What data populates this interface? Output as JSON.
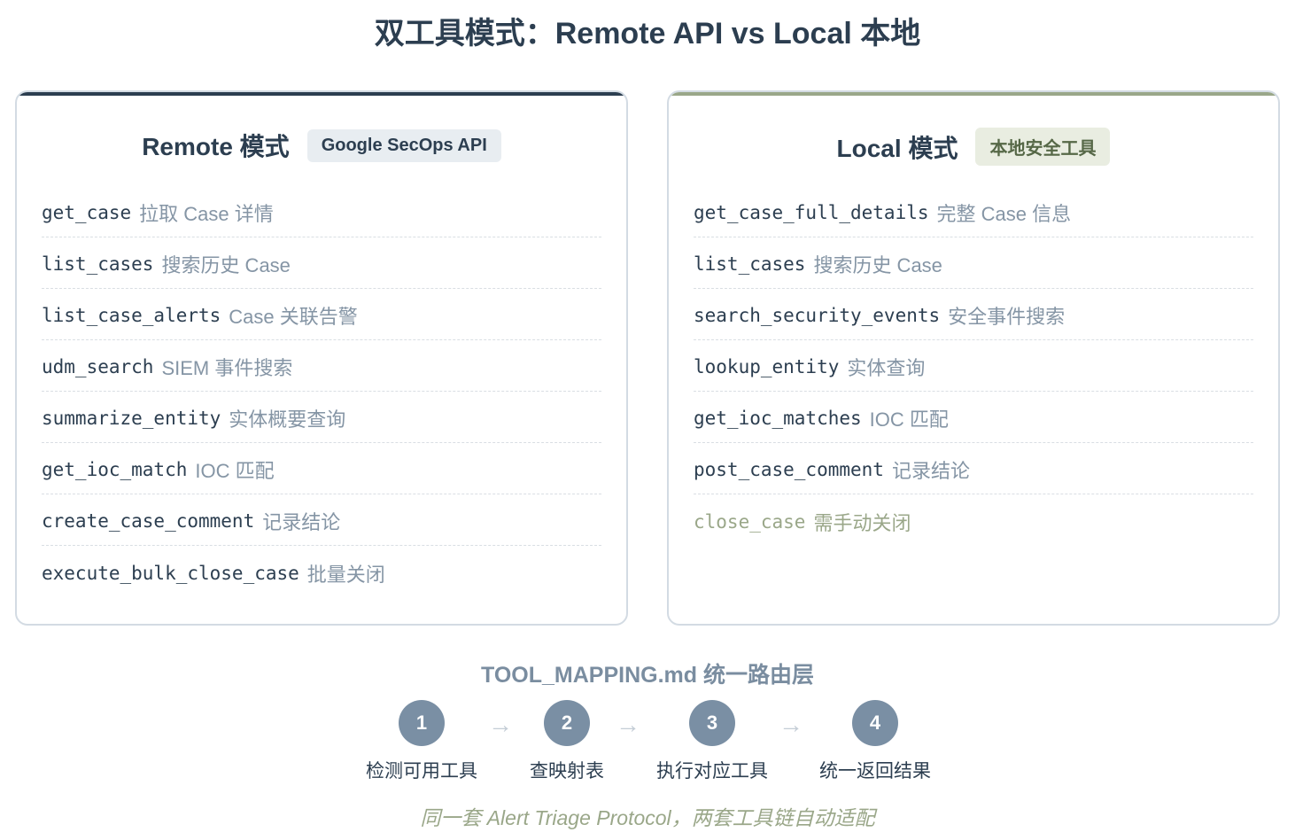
{
  "page": {
    "title": "双工具模式：Remote API vs Local 本地"
  },
  "remote": {
    "title": "Remote 模式",
    "badge": "Google SecOps API",
    "tools": [
      {
        "name": "get_case",
        "desc": "拉取 Case 详情"
      },
      {
        "name": "list_cases",
        "desc": "搜索历史 Case"
      },
      {
        "name": "list_case_alerts",
        "desc": "Case 关联告警"
      },
      {
        "name": "udm_search",
        "desc": "SIEM 事件搜索"
      },
      {
        "name": "summarize_entity",
        "desc": "实体概要查询"
      },
      {
        "name": "get_ioc_match",
        "desc": "IOC 匹配"
      },
      {
        "name": "create_case_comment",
        "desc": "记录结论"
      },
      {
        "name": "execute_bulk_close_case",
        "desc": "批量关闭"
      }
    ]
  },
  "local": {
    "title": "Local 模式",
    "badge": "本地安全工具",
    "tools": [
      {
        "name": "get_case_full_details",
        "desc": "完整 Case 信息"
      },
      {
        "name": "list_cases",
        "desc": "搜索历史 Case"
      },
      {
        "name": "search_security_events",
        "desc": "安全事件搜索"
      },
      {
        "name": "lookup_entity",
        "desc": "实体查询"
      },
      {
        "name": "get_ioc_matches",
        "desc": "IOC 匹配"
      },
      {
        "name": "post_case_comment",
        "desc": "记录结论"
      },
      {
        "name": "close_case",
        "desc": "需手动关闭"
      }
    ]
  },
  "mapping": {
    "title": "TOOL_MAPPING.md 统一路由层",
    "arrow": "→",
    "steps": [
      {
        "num": "1",
        "label": "检测可用工具"
      },
      {
        "num": "2",
        "label": "查映射表"
      },
      {
        "num": "3",
        "label": "执行对应工具"
      },
      {
        "num": "4",
        "label": "统一返回结果"
      }
    ]
  },
  "footer": {
    "note": "同一套 Alert Triage Protocol，两套工具链自动适配"
  },
  "colors": {
    "dark": "#2c3e50",
    "accent_green": "#9aa789",
    "step_circle": "#7a8fa4",
    "muted_text": "#8595a5"
  }
}
